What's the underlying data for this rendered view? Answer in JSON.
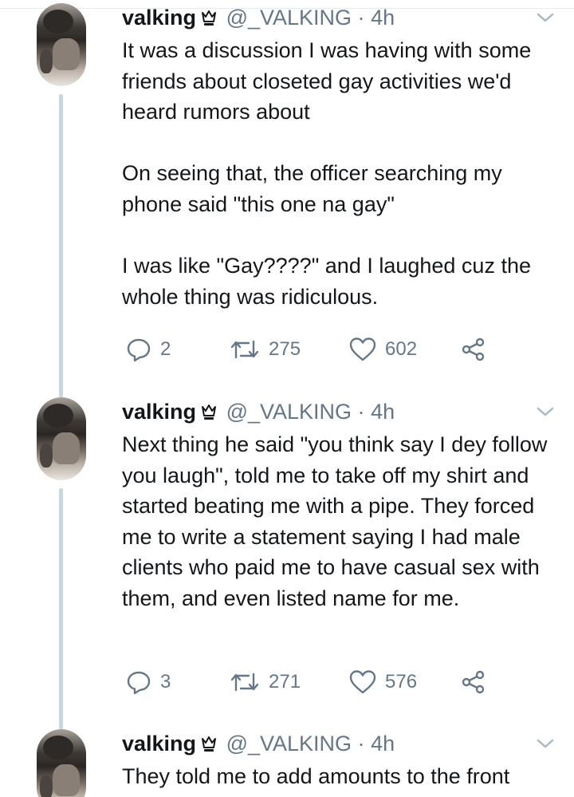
{
  "tweets": [
    {
      "name": "valking",
      "handle": "@_VALKING",
      "separator": "·",
      "time": "4h",
      "paragraphs": [
        "It was a discussion I was having with some friends about closeted gay activities we'd heard rumors about",
        "On seeing that, the officer searching my phone said \"this one na gay\"",
        "I was like \"Gay????\" and I laughed cuz the whole thing was ridiculous."
      ],
      "replies": "2",
      "retweets": "275",
      "likes": "602"
    },
    {
      "name": "valking",
      "handle": "@_VALKING",
      "separator": "·",
      "time": "4h",
      "paragraphs": [
        "Next thing he said \"you think say I dey follow you laugh\", told me to take off my shirt and started beating me with a pipe. They forced me to write a statement saying I had male clients who paid me to have casual sex with them, and even listed name for me."
      ],
      "replies": "3",
      "retweets": "271",
      "likes": "576"
    },
    {
      "name": "valking",
      "handle": "@_VALKING",
      "separator": "·",
      "time": "4h",
      "paragraphs": [
        "They told me to add amounts to the front"
      ]
    }
  ],
  "icons": {
    "badge": "crown-badge-icon",
    "menu": "chevron-down-icon",
    "reply": "reply-bubble-icon",
    "retweet": "retweet-icon",
    "like": "heart-icon",
    "share": "share-icon"
  },
  "colors": {
    "text": "#14171a",
    "secondary": "#657786",
    "thread_line": "#ccd6dd",
    "divider": "#e6ecf0",
    "background": "#ffffff"
  }
}
